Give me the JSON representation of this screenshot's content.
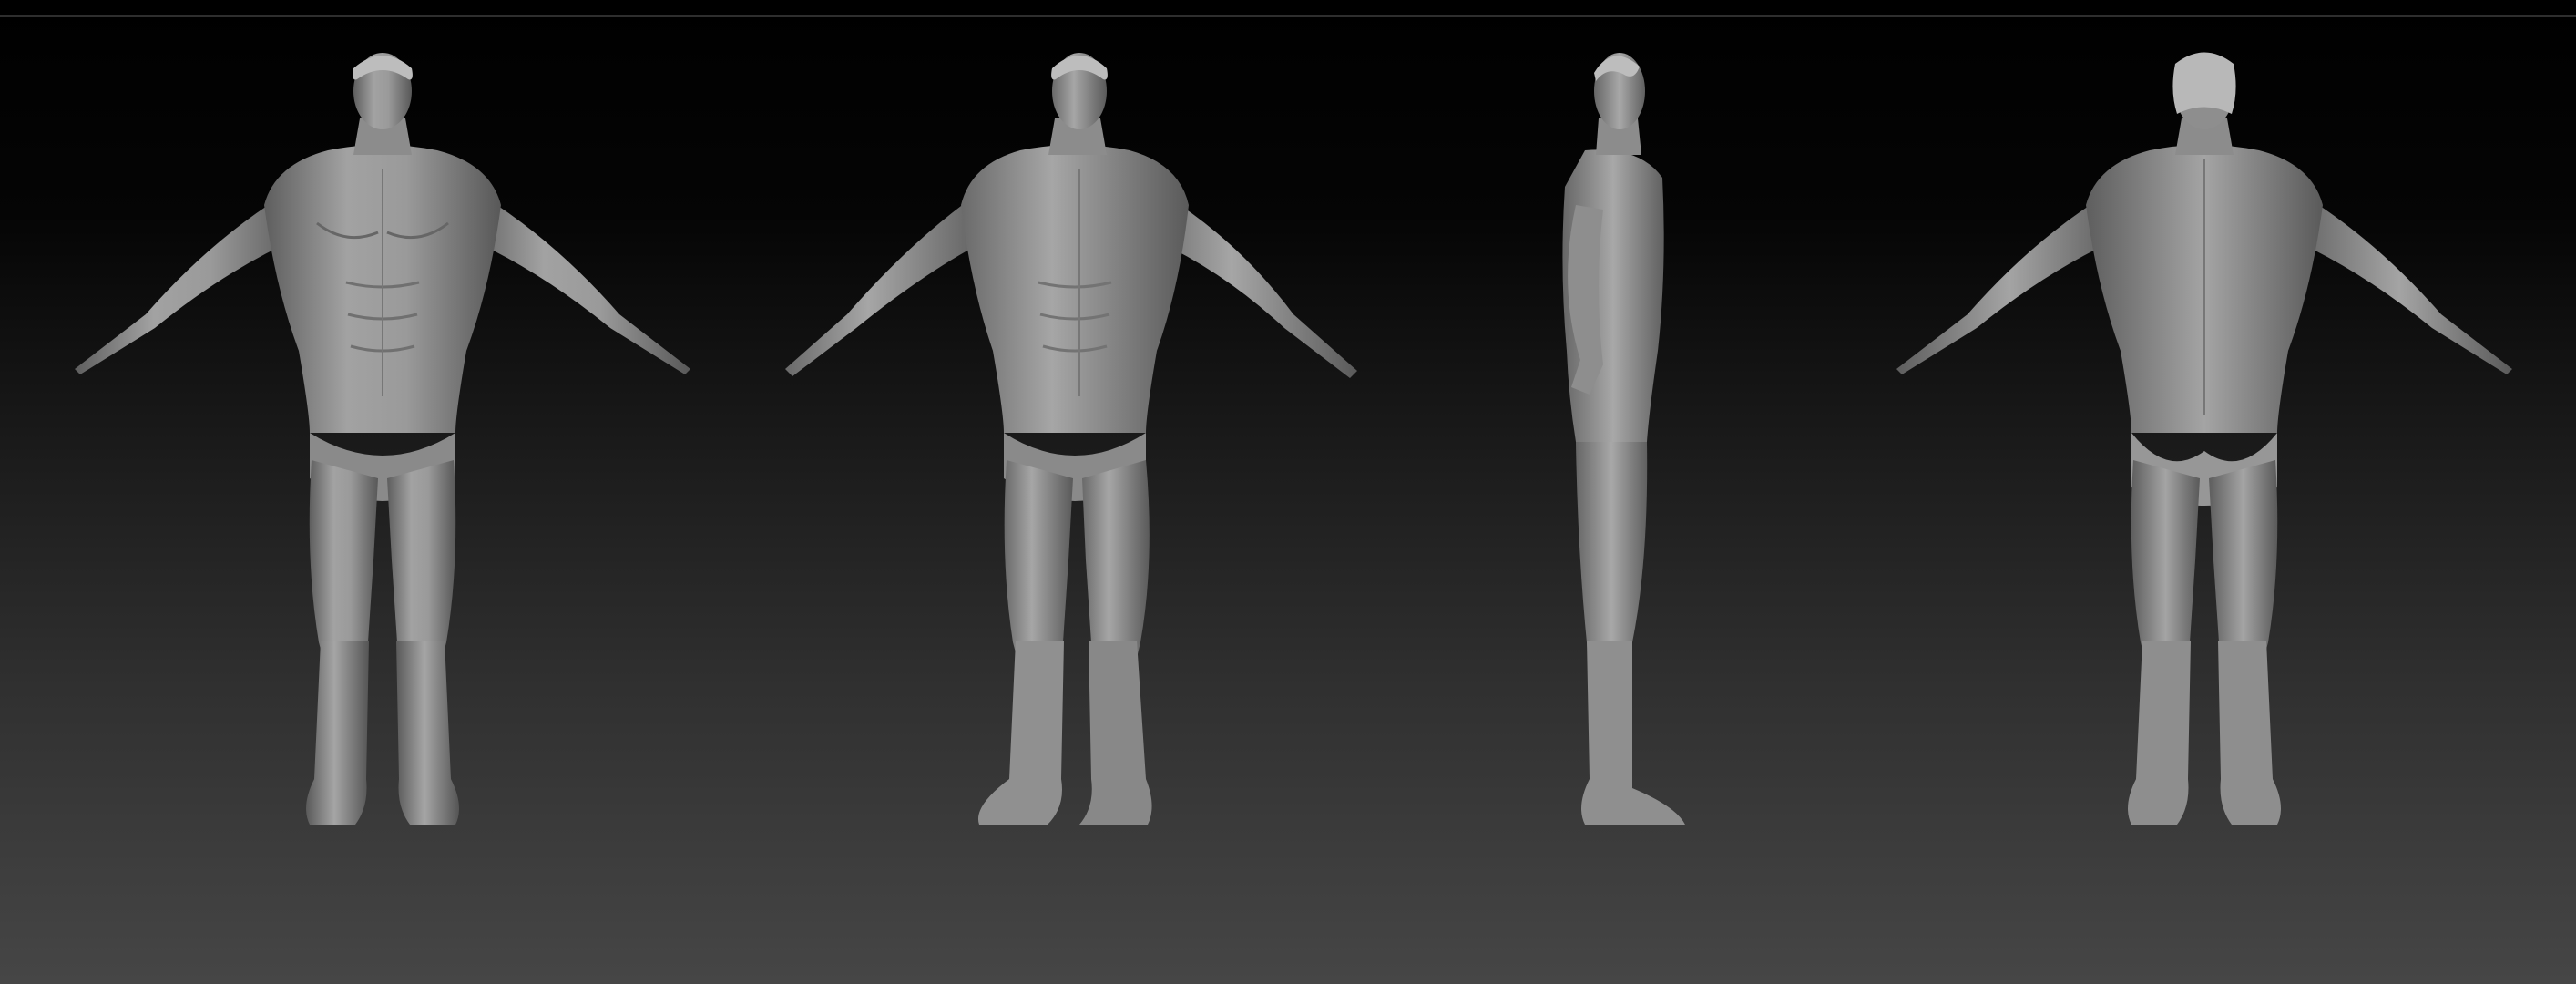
{
  "viewport": {
    "background_top": "#000000",
    "background_bottom": "#464646",
    "model_color": "#8e8e8e",
    "model_shadow": "#5c5c5c",
    "model_highlight": "#b5b5b5"
  },
  "turnaround": {
    "views": [
      "front",
      "three-quarter",
      "side",
      "back"
    ]
  }
}
